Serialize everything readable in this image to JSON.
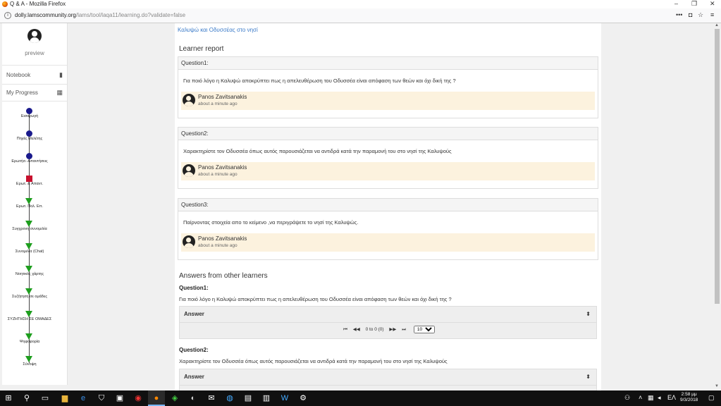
{
  "window": {
    "title": "Q & A - Mozilla Firefox",
    "min": "–",
    "max": "❐",
    "close": "✕"
  },
  "urlbar": {
    "host": "dolly.lamscommunity.org",
    "path": "/lams/tool/laqa11/learning.do?validate=false",
    "more": "•••",
    "pocket": "◘",
    "star": "☆",
    "menu": "≡"
  },
  "sidebar": {
    "preview_label": "preview",
    "notebook_label": "Notebook",
    "progress_label": "My Progress",
    "activities": [
      {
        "label": "Εισαγωγή",
        "status": "done"
      },
      {
        "label": "Πηγές Μελέτης",
        "status": "done"
      },
      {
        "label": "Ερωτήσ.-Απαντήσεις",
        "status": "done"
      },
      {
        "label": "Ερωτ. & Απαντ.",
        "status": "current"
      },
      {
        "label": "Ερωτ. Πολ. Επ.",
        "status": "todo"
      },
      {
        "label": "Συγχρονη συνομιλία",
        "status": "todo"
      },
      {
        "label": "Συνομιλία (Chat)",
        "status": "todo"
      },
      {
        "label": "Νοητικός χάρτης",
        "status": "todo"
      },
      {
        "label": "Συζήτηση σε ομάδες",
        "status": "todo"
      },
      {
        "label": "ΣΥΖΗΤΗΣΗ ΣΕ ΟΜΑΔΕΣ",
        "status": "todo"
      },
      {
        "label": "Ψηφοφορία",
        "status": "todo"
      },
      {
        "label": "Σύνοψη",
        "status": "todo"
      }
    ]
  },
  "main": {
    "breadcrumb": "Καλυψώ και Οδυσσέας στο νησί",
    "learner_report_title": "Learner report",
    "questions": [
      {
        "head": "Question1:",
        "text": "Για ποιό λόγο η Καλυψώ αποκρύπτει πως η απελευθέρωση του Οδυσσέα είναι απόφαση των θεών και όχι δική της ?",
        "author": "Panos Zavitsanakis",
        "time": "about a minute ago"
      },
      {
        "head": "Question2:",
        "text": "Χαρακτηρίστε τον Οδυσσέα όπως αυτός παρουσιάζεται να αντιδρά κατά την  παραμονή του στο νησί της Καλυψούς",
        "author": "Panos Zavitsanakis",
        "time": "about a minute ago"
      },
      {
        "head": "Question3:",
        "text": "Παίρνοντας στοιχεία απο το κείμενο ,να περιγράψετε το νησί της Καλυψώς.",
        "author": "Panos Zavitsanakis",
        "time": "about a minute ago"
      }
    ],
    "others_title": "Answers from other learners",
    "others": [
      {
        "head": "Question1:",
        "text": "Για ποιό λόγο η Καλυψώ αποκρύπτει πως η απελευθέρωση του Οδυσσέα είναι απόφαση των θεών και όχι δική της ?",
        "col": "Answer",
        "pager": "0 to 0 (0)",
        "page_size": "10"
      },
      {
        "head": "Question2:",
        "text": "Χαρακτηρίστε τον Οδυσσέα όπως αυτός παρουσιάζεται να αντιδρά κατά την  παραμονή του στο νησί της Καλυψούς",
        "col": "Answer"
      }
    ]
  },
  "taskbar": {
    "lang": "ΕΛ",
    "time": "2:58 μμ",
    "date": "9/3/2018"
  }
}
